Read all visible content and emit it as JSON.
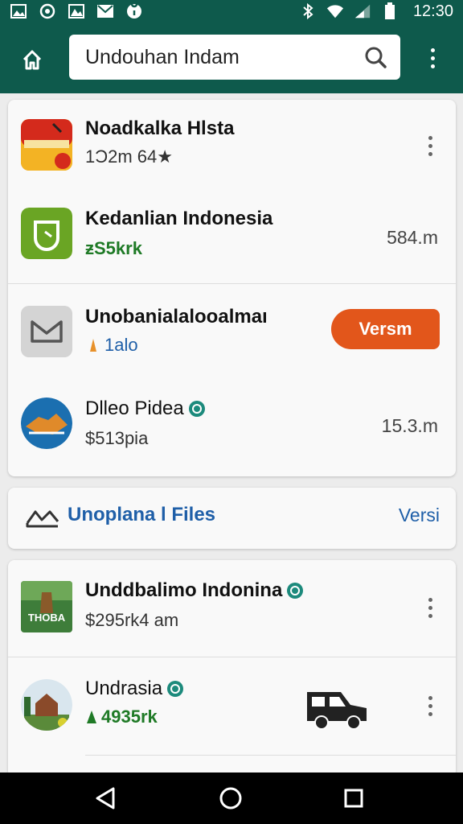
{
  "status_bar": {
    "time": "12:30",
    "notification_icons": [
      "gallery-icon",
      "chat-icon",
      "gallery-icon",
      "mail-icon",
      "location-icon"
    ],
    "system_icons": [
      "bluetooth-icon",
      "wifi-icon",
      "signal-icon",
      "battery-icon"
    ]
  },
  "app_bar": {
    "search_value": "Undouhan Indam",
    "colors": {
      "bar": "#0e5a4c",
      "accent": "#e2561b",
      "link": "#1f5fa8",
      "green": "#1f7a26"
    }
  },
  "list1": {
    "items": [
      {
        "title": "Noadkalka Hlsta",
        "subtitle": "1Ͻ2m 64★",
        "trailing": "more"
      },
      {
        "title": "Kedanlian Indonesia",
        "subtitle": "ƶS5krk",
        "size": "584.m"
      },
      {
        "title": "Unobanialalooalmaı",
        "subtitle": "1alo",
        "action_label": "Versm"
      },
      {
        "title": "Dlleo Pidea",
        "subtitle": "$513pia",
        "size": "15.3.m"
      }
    ]
  },
  "files_card": {
    "label": "Unoplana l Files",
    "version": "Versi"
  },
  "list2": {
    "items": [
      {
        "title": "Unddbalimo Indonina",
        "subtitle": "$295rk4 am",
        "icon_text": "THOBA"
      },
      {
        "title": "Undrasia",
        "subtitle": "4935rk"
      }
    ]
  }
}
